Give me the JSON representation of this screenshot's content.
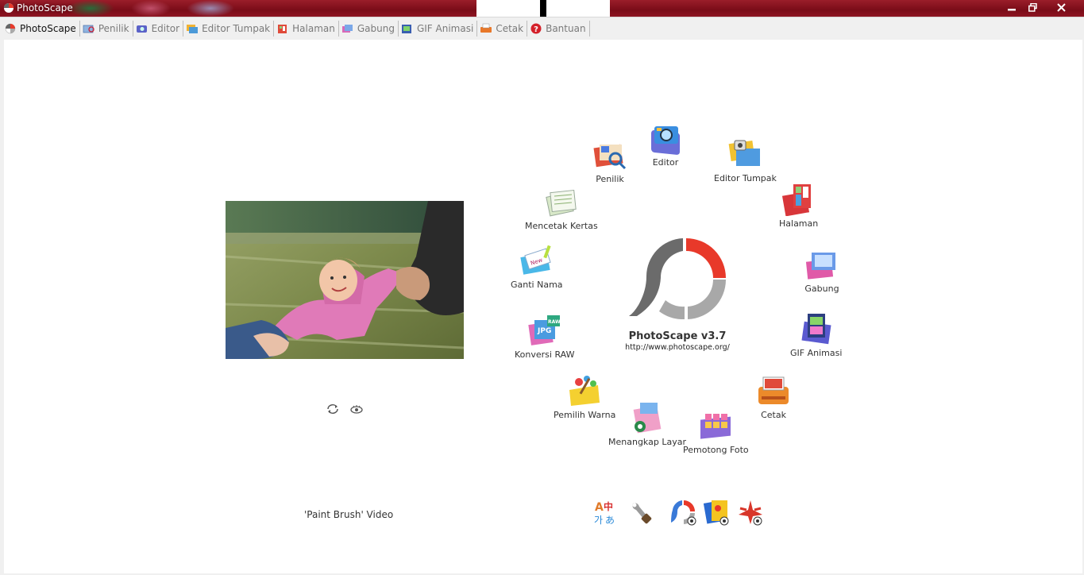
{
  "window": {
    "title": "PhotoScape"
  },
  "tabs": [
    {
      "label": "PhotoScape",
      "icon": "photoscape-icon"
    },
    {
      "label": "Penilik",
      "icon": "viewer-icon"
    },
    {
      "label": "Editor",
      "icon": "editor-icon"
    },
    {
      "label": "Editor Tumpak",
      "icon": "batch-editor-icon"
    },
    {
      "label": "Halaman",
      "icon": "page-icon"
    },
    {
      "label": "Gabung",
      "icon": "combine-icon"
    },
    {
      "label": "GIF Animasi",
      "icon": "gif-icon"
    },
    {
      "label": "Cetak",
      "icon": "print-icon"
    },
    {
      "label": "Bantuan",
      "icon": "help-icon"
    }
  ],
  "home": {
    "brand_name": "PhotoScape v3.7",
    "brand_url": "http://www.photoscape.org/",
    "video_label": "'Paint Brush' Video",
    "logo_colors": {
      "red": "#e8392a",
      "dark": "#6b6b6b",
      "light": "#a8a8a8"
    },
    "ring": [
      {
        "label": "Editor"
      },
      {
        "label": "Editor Tumpak"
      },
      {
        "label": "Halaman"
      },
      {
        "label": "Gabung"
      },
      {
        "label": "GIF Animasi"
      },
      {
        "label": "Cetak"
      },
      {
        "label": "Pemotong Foto"
      },
      {
        "label": "Menangkap Layar"
      },
      {
        "label": "Pemilih Warna"
      },
      {
        "label": "Konversi RAW"
      },
      {
        "label": "Ganti Nama"
      },
      {
        "label": "Mencetak Kertas"
      },
      {
        "label": "Penilik"
      }
    ],
    "tools": [
      "language-icon",
      "settings-icon",
      "photoscape-update-icon",
      "photoscape-plugin-icon",
      "ad-icon"
    ]
  }
}
